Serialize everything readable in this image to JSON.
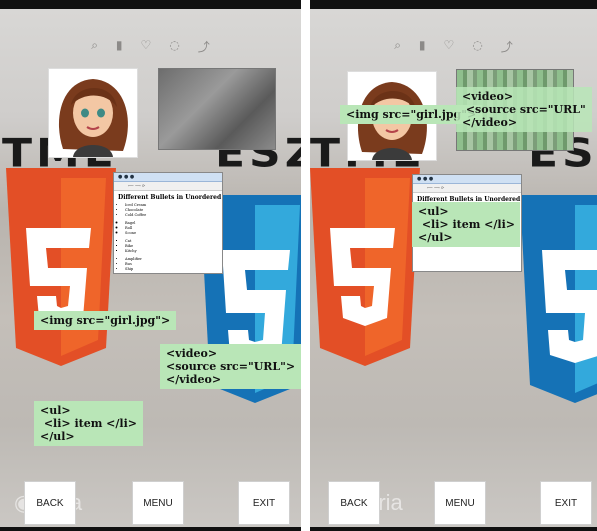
{
  "left_view": {
    "img_label": "<img src=\"girl.jpg\">",
    "video_label": "<video>\n<source src=\"URL\">\n</video>",
    "list_label": "<ul>\n <li> item </li>\n</ul>",
    "buttons": {
      "back": "BACK",
      "menu": "MENU",
      "exit": "EXIT"
    },
    "watermark": "foria"
  },
  "right_view": {
    "img_label": "<img src=\"girl.jpg\">",
    "video_label": "<video>\n <source src=\"URL\"\n</video>",
    "list_label": "<ul>\n <li> item </li>\n</ul>",
    "buttons": {
      "back": "BACK",
      "menu": "MENU",
      "exit": "EXIT"
    },
    "watermark": "foria"
  },
  "browser_preview": {
    "title": "Different Bullets in Unordered List",
    "groups": [
      [
        "Iced Cream",
        "Chocolate",
        "Cold Coffee"
      ],
      [
        "Bagel",
        "Roll",
        "Scone"
      ],
      [
        "Cat",
        "Bike",
        "Kitchy"
      ],
      [
        "Amplifier",
        "Bus",
        "Ship"
      ]
    ]
  },
  "scene": {
    "banner_left_a": "TML",
    "banner_left_b": "ESZ",
    "banner_right_a": "TML",
    "banner_right_b": "ESZ",
    "icons": [
      "search-icon",
      "mic-icon",
      "heart-icon",
      "bubble-icon",
      "share-icon"
    ]
  }
}
